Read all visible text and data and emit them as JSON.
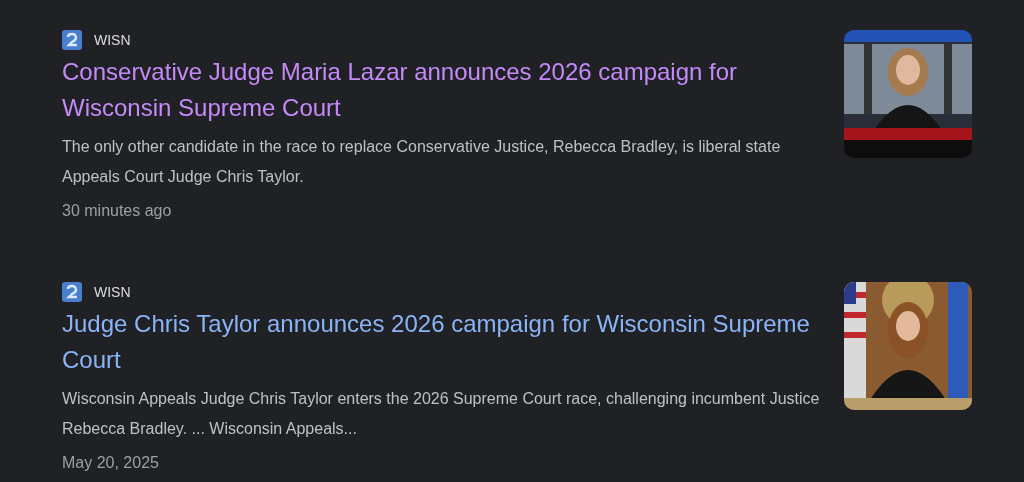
{
  "results": [
    {
      "source": "WISN",
      "title": "Conservative Judge Maria Lazar announces 2026 campaign for Wisconsin Supreme Court",
      "visited": true,
      "snippet": "The only other candidate in the race to replace Conservative Justice, Rebecca Bradley, is liberal state Appeals Court Judge Chris Taylor.",
      "time": "30 minutes ago"
    },
    {
      "source": "WISN",
      "title": "Judge Chris Taylor announces 2026 campaign for Wisconsin Supreme Court",
      "visited": false,
      "snippet": "Wisconsin Appeals Judge Chris Taylor enters the 2026 Supreme Court race, challenging incumbent Justice Rebecca Bradley. ... Wisconsin Appeals...",
      "time": "May 20, 2025"
    }
  ]
}
